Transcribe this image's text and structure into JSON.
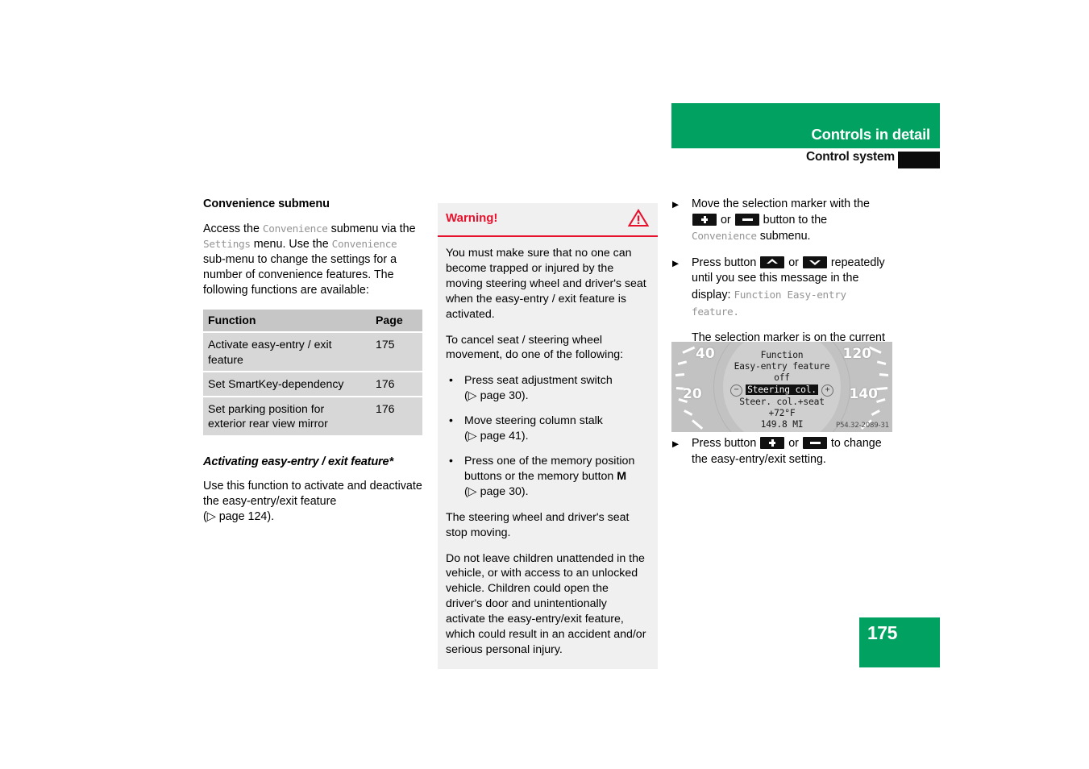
{
  "header": {
    "title": "Controls in detail",
    "subtitle": "Control system",
    "green": "#00a161"
  },
  "left_column": {
    "heading": "Convenience submenu",
    "intro": {
      "s1": "Access the ",
      "m1": "Convenience",
      "s2": " submenu via the ",
      "m2": "Settings",
      "s3": " menu. Use the ",
      "m3": "Convenience",
      "s4": " sub-menu to change the settings for a number of convenience features. The following functions are available:"
    },
    "table": {
      "headers": [
        "Function",
        "Page"
      ],
      "rows": [
        {
          "function": "Activate easy-entry / exit feature",
          "page": "175"
        },
        {
          "function": "Set SmartKey-dependency",
          "page": "176"
        },
        {
          "function": "Set parking position for exterior rear view mirror",
          "page": "176"
        }
      ]
    },
    "sub_heading": "Activating easy-entry / exit feature*",
    "sub_body_1": "Use this function to activate and deactivate the easy-entry/exit feature",
    "sub_body_ref": "(▷ page 124)."
  },
  "warning": {
    "title": "Warning!",
    "icon": "warning-triangle-icon",
    "color": "#e8112d",
    "paragraph_1": "You must make sure that no one can become trapped or injured by the moving steering wheel and driver's seat when the easy-entry / exit feature is activated.",
    "paragraph_2": "To cancel seat / steering wheel movement, do one of the following:",
    "bullets": [
      {
        "text": "Press seat adjustment switch",
        "ref": "(▷ page 30)."
      },
      {
        "text": "Move steering column stalk",
        "ref": "(▷ page 41)."
      },
      {
        "text_a": "Press one of the memory position buttons or the memory button ",
        "bold": "M",
        "ref": "(▷ page 30)."
      }
    ],
    "paragraph_3": "The steering wheel and driver's seat stop moving.",
    "paragraph_4": "Do not leave children unattended in the vehicle, or with access to an unlocked vehicle. Children could open the driver's door and unintentionally activate the easy-entry/exit feature, which could result in an accident and/or serious personal injury."
  },
  "right_column": {
    "step_1": {
      "a": "Move the selection marker with the ",
      "btn1": "plus-button-icon",
      "b": " or ",
      "btn2": "minus-button-icon",
      "c": " button to the ",
      "mono": "Convenience",
      "d": " submenu."
    },
    "step_2": {
      "a": "Press button ",
      "btn1": "up-arrow-button-icon",
      "b": " or ",
      "btn2": "down-arrow-button-icon",
      "c": " repeatedly until you see this message in the display: ",
      "mono": "Function Easy-entry feature",
      "d": "."
    },
    "note": "The selection marker is on the current setting.",
    "step_3": {
      "a": "Press button ",
      "btn1": "plus-button-icon",
      "b": " or ",
      "btn2": "minus-button-icon",
      "c": " to change the easy-entry/exit setting."
    }
  },
  "cluster_figure": {
    "photo_id": "P54.32-2089-31",
    "gauge_numbers": [
      "40",
      "20",
      "120",
      "140"
    ],
    "display_lines": {
      "line_1": "Function",
      "line_2": "Easy-entry feature",
      "line_3": "off",
      "line_4_left_icon": "−",
      "line_4_highlight": "Steering col.",
      "line_4_right_icon": "+",
      "line_5": "Steer. col.+seat",
      "line_6": "+72°F",
      "line_7": "149.8 MI"
    }
  },
  "footer": {
    "page_number": "175"
  }
}
